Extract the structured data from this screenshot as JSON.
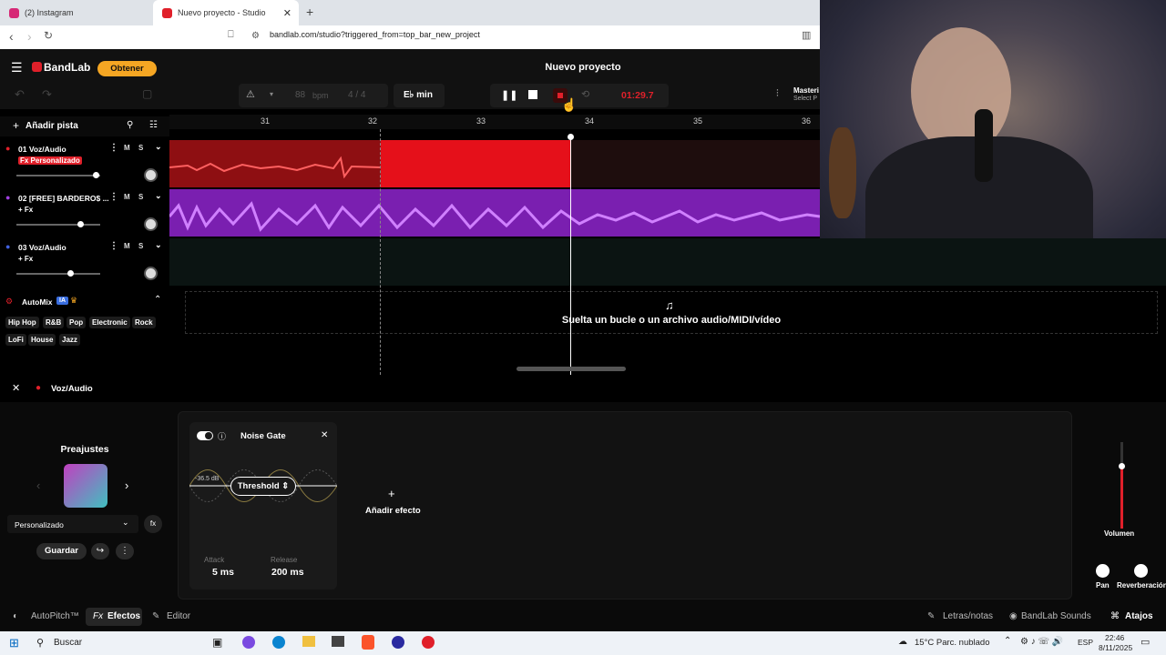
{
  "browser": {
    "tabs": [
      {
        "label": "(2) Instagram",
        "color": "#d62976"
      },
      {
        "label": "Nuevo proyecto - Studio",
        "color": "#e0202a"
      }
    ],
    "url": "bandlab.com/studio?triggered_from=top_bar_new_project"
  },
  "app": {
    "brand": "BandLab",
    "obtener": "Obtener",
    "project_title": "Nuevo proyecto",
    "bpm_value": "88",
    "bpm_unit": "bpm",
    "time_sig": "4 / 4",
    "key": "E♭ min",
    "time": "01:29.7",
    "master_label": "Masteri",
    "master_sub": "Select P",
    "add_track": "Añadir pista",
    "accent": "#f5a623"
  },
  "ruler": [
    "31",
    "32",
    "33",
    "34",
    "35",
    "36"
  ],
  "tracks": [
    {
      "name": "01  Voz/Audio",
      "fx": "Fx Personalizado",
      "m": "M",
      "s": "S",
      "color": "#e0202a",
      "volume_pct": 0.93
    },
    {
      "name": "02  [FREE] BARDERO$ ...",
      "fx": "+ Fx",
      "m": "M",
      "s": "S",
      "color": "#a040e0",
      "volume_pct": 0.75
    },
    {
      "name": "03  Voz/Audio",
      "fx": "+ Fx",
      "m": "M",
      "s": "S",
      "color": "#4060e0",
      "volume_pct": 0.65
    }
  ],
  "automix": {
    "label": "AutoMix",
    "badge": "IA",
    "genres": [
      "Hip Hop",
      "R&B",
      "Pop",
      "Electronic",
      "Rock",
      "LoFi",
      "House",
      "Jazz"
    ]
  },
  "dropzone": "Suelta un bucle o un archivo audio/MIDI/vídeo",
  "fx_panel": {
    "track_name": "Voz/Audio",
    "presets_title": "Preajustes",
    "preset_name": "Personalizado",
    "save_label": "Guardar",
    "effect": {
      "name": "Noise Gate",
      "db_label": "-36.5 dB",
      "threshold_label": "Threshold",
      "attack_label": "Attack",
      "attack_value": "5 ms",
      "release_label": "Release",
      "release_value": "200 ms"
    },
    "add_effect": "Añadir efecto",
    "volume_label": "Volumen",
    "pan_label": "Pan",
    "reverb_label": "Reverberación"
  },
  "bottom_tabs": {
    "autopitch": "AutoPitch™",
    "efectos": "Efectos",
    "editor": "Editor",
    "letras": "Letras/notas",
    "sounds": "BandLab Sounds",
    "atajos": "Atajos"
  },
  "taskbar": {
    "search": "Buscar",
    "weather": "15°C  Parc. nublado",
    "lang": "ESP",
    "time": "22:46",
    "date": "8/11/2025"
  }
}
